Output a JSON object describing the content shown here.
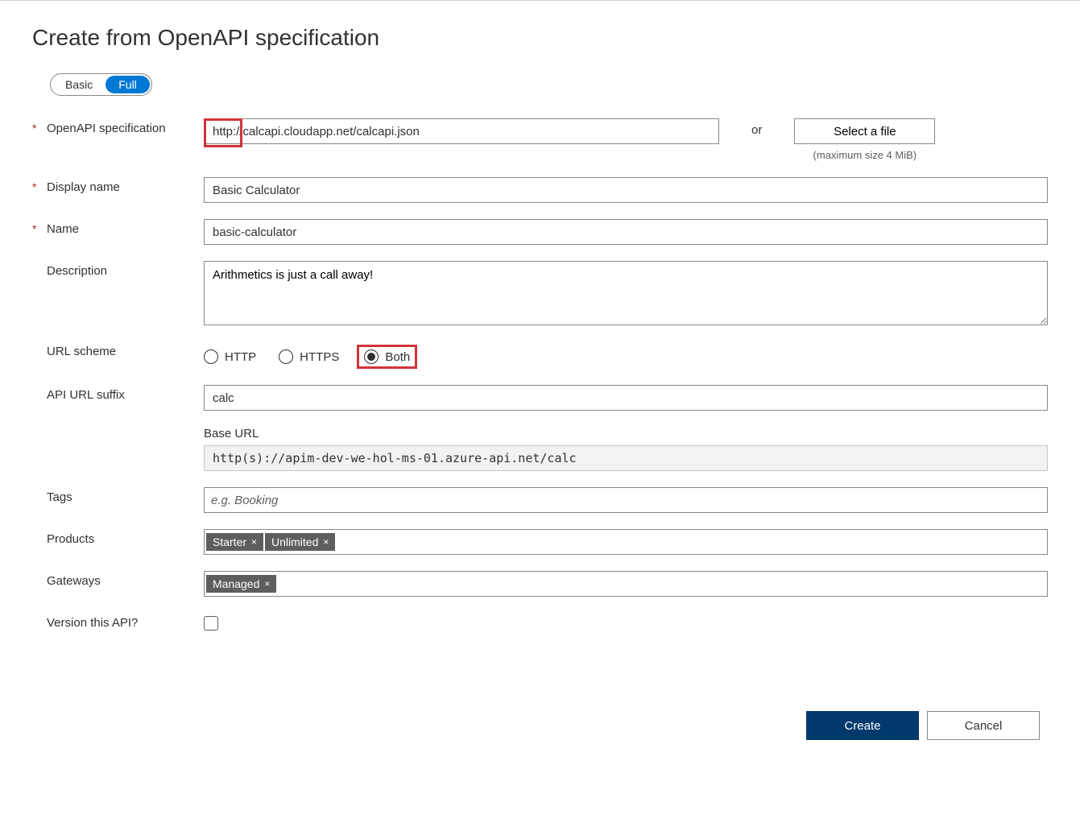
{
  "title": "Create from OpenAPI specification",
  "toggle": {
    "basic": "Basic",
    "full": "Full",
    "active": "Full"
  },
  "fields": {
    "openapi_spec": {
      "label": "OpenAPI specification",
      "required": true,
      "value": "http://calcapi.cloudapp.net/calcapi.json",
      "or": "or",
      "file_btn": "Select a file",
      "file_hint": "(maximum size 4 MiB)"
    },
    "display_name": {
      "label": "Display name",
      "required": true,
      "value": "Basic Calculator"
    },
    "name": {
      "label": "Name",
      "required": true,
      "value": "basic-calculator"
    },
    "description": {
      "label": "Description",
      "required": false,
      "value": "Arithmetics is just a call away!"
    },
    "url_scheme": {
      "label": "URL scheme",
      "options": [
        {
          "label": "HTTP",
          "checked": false
        },
        {
          "label": "HTTPS",
          "checked": false
        },
        {
          "label": "Both",
          "checked": true
        }
      ]
    },
    "api_url_suffix": {
      "label": "API URL suffix",
      "value": "calc"
    },
    "base_url": {
      "label": "Base URL",
      "value": "http(s)://apim-dev-we-hol-ms-01.azure-api.net/calc"
    },
    "tags": {
      "label": "Tags",
      "placeholder": "e.g. Booking",
      "items": []
    },
    "products": {
      "label": "Products",
      "items": [
        "Starter",
        "Unlimited"
      ]
    },
    "gateways": {
      "label": "Gateways",
      "items": [
        "Managed"
      ]
    },
    "version": {
      "label": "Version this API?",
      "checked": false
    }
  },
  "footer": {
    "create": "Create",
    "cancel": "Cancel"
  }
}
